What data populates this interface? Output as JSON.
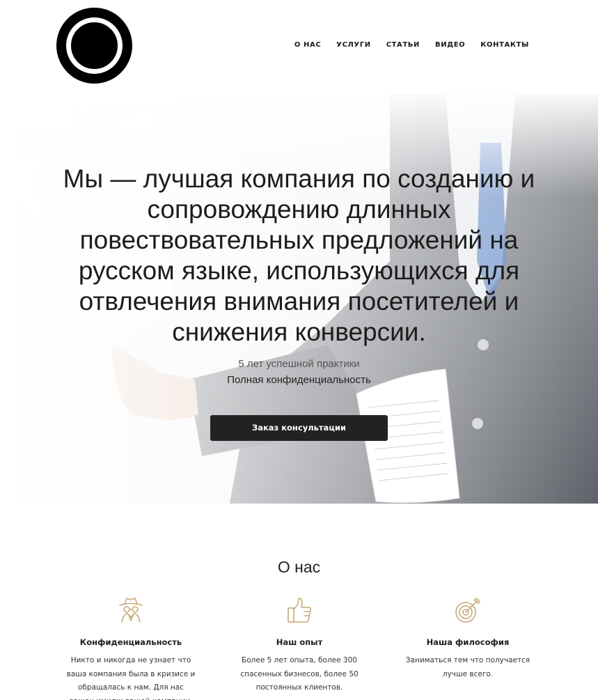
{
  "header": {
    "logo_name": "ring-logo",
    "nav": [
      {
        "label": "О НАС"
      },
      {
        "label": "УСЛУГИ"
      },
      {
        "label": "СТАТЬИ"
      },
      {
        "label": "ВИДЕО"
      },
      {
        "label": "КОНТАКТЫ"
      }
    ]
  },
  "hero": {
    "title": "Мы — лучшая компания по созданию и сопровождению длинных повествовательных предложений на русском языке, использующихся для отвлечения внимания посетителей и снижения конверсии.",
    "subtitle_1": "5 лет успешной практики",
    "subtitle_2": "Полная конфиденциальность",
    "cta_label": "Заказ консультации",
    "background": "businessman-handing-documents-photo"
  },
  "about": {
    "title": "О нас",
    "accent_color": "#c9a878",
    "features": [
      {
        "icon": "spy-icon",
        "title": "Конфиденциальность",
        "text": "Никто и никогда не узнает что ваша компания была в кризисе и обращалась к нам. Для нас важен имидж вашей компании."
      },
      {
        "icon": "thumbs-up-icon",
        "title": "Наш опыт",
        "text": "Более 5 лет опыта, более 300 спасенных бизнесов, более 50 постоянных клиентов."
      },
      {
        "icon": "target-icon",
        "title": "Наша философия",
        "text": "Заниматься тем что получается лучше всего."
      }
    ]
  }
}
